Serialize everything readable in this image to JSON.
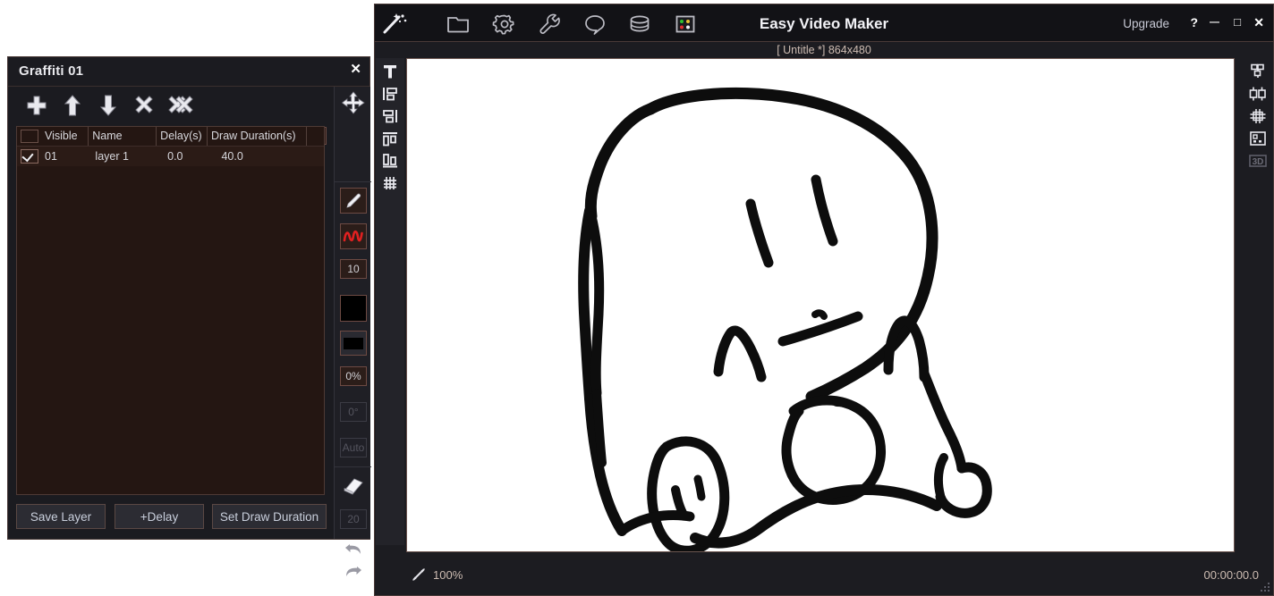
{
  "graffiti_panel": {
    "title": "Graffiti 01",
    "close_label": "✕",
    "toolbar": {
      "add_icon": "plus-icon",
      "move_up_icon": "arrow-up-icon",
      "move_down_icon": "arrow-down-icon",
      "delete_icon": "cross-icon",
      "delete_all_icon": "double-cross-icon",
      "move_tool_icon": "move-arrows-icon"
    },
    "name_input": {
      "value": "Graffiti 01",
      "placeholder": "Graffiti 01"
    },
    "table": {
      "headers": [
        "Visible",
        "Name",
        "Delay(s)",
        "Draw Duration(s)"
      ],
      "rows": [
        {
          "index": "01",
          "name": "layer 1",
          "delay": "0.0",
          "draw_duration": "40.0",
          "visible": true
        }
      ]
    },
    "buttons": {
      "save_layer": "Save Layer",
      "add_delay": "+Delay",
      "set_draw_duration": "Set Draw Duration"
    },
    "tools": {
      "pen_icon": "pencil-icon",
      "stroke_icon": "squiggle-icon",
      "stroke_color_hex": "#d32020",
      "brush_size": "10",
      "fill_color_hex": "#000000",
      "line_color_hex": "#000000",
      "opacity": "0%",
      "rotation": "0°",
      "auto": "Auto",
      "eraser_icon": "eraser-icon",
      "eraser_size": "20",
      "undo_icon": "undo-icon",
      "redo_icon": "redo-icon"
    }
  },
  "main_window": {
    "app_title": "Easy Video Maker",
    "document_title": "[ Untitle *]  864x480",
    "upgrade_label": "Upgrade",
    "window_controls": {
      "help": "?",
      "minimize": "—",
      "maximize": "□",
      "close": "✕"
    },
    "header_icons": [
      "magic-wand-icon",
      "folder-icon",
      "gear-icon",
      "wrench-icon",
      "speech-bubble-icon",
      "database-icon",
      "color-palette-icon"
    ],
    "left_tools": [
      "text-tool-icon",
      "align-left-icon",
      "align-right-icon",
      "align-top-icon",
      "align-bottom-icon",
      "grid-icon"
    ],
    "right_tools": [
      "layout-grid-icon",
      "layout-split-icon",
      "layout-merge-icon",
      "layout-preview-icon",
      "3d-icon"
    ],
    "right_tools_labels": {
      "three_d": "3D"
    },
    "status_bar": {
      "fit_icon": "fit-to-screen-icon",
      "zoom": "100%",
      "timecode": "00:00:00.0"
    },
    "canvas": {
      "background_hex": "#ffffff",
      "drawing_name": "hand-drawn-creature-doodle",
      "stroke_hex": "#0a0a0a"
    }
  }
}
